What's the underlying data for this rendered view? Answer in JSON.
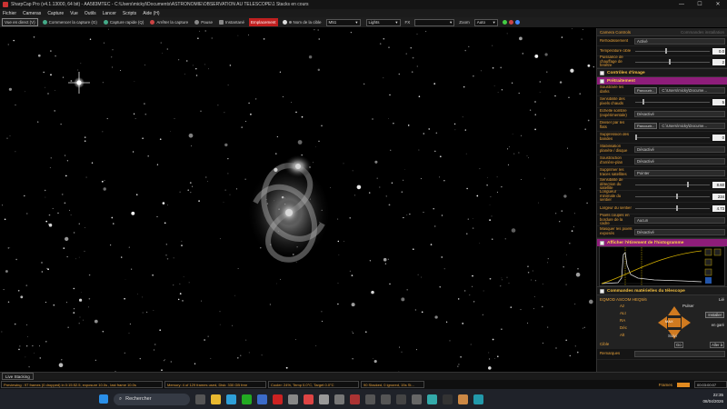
{
  "titlebar": {
    "title": "SharpCap Pro (v4.1.13000, 64 bit) - AA583MTEC - C:\\Users\\mickyl\\Documents\\ASTRONOMIE\\OBSERVATION AU TELESCOPE\\1 Stacks en cours"
  },
  "menu": [
    "Fichier",
    "Cameras",
    "Capture",
    "Vue",
    "Outils",
    "Lancer",
    "Scripts",
    "Aide (H)"
  ],
  "toolbar": {
    "live": "Vue en direct (V)",
    "start_capture": "Commencer la capture (G)",
    "quick_capture": "Capture rapide (Q)",
    "stop_capture": "Arrêter la capture",
    "pause": "Pause",
    "snapshot": "Instantané",
    "framing": "Emplacement",
    "target_label": "Nom de la cible",
    "target_value": "M51",
    "frame_type": "Lights",
    "fx_label": "FX",
    "fx_value": "",
    "zoom_label": "Zoom",
    "zoom_value": "Auto"
  },
  "panel": {
    "header": "Camera Controls",
    "minimized": "Commandes installation",
    "camera_rows": [
      {
        "label": "Refroidissement",
        "value": "Activé"
      },
      {
        "label": "Température cible",
        "num": "0.0"
      },
      {
        "label": "Puissance de chauffage de fenêtre",
        "num": "2"
      }
    ],
    "image_controls": "Contrôles d'image",
    "preprocessing": "Prétraitement",
    "pre_rows": [
      {
        "label": "Soustraire les darks",
        "btn": "Parcourir...",
        "value": "C:\\Users\\micky\\Docume..."
      },
      {
        "label": "Sensibilité des pixels chauds",
        "num": "5"
      },
      {
        "label": "Échelle sombre (expérimentale)",
        "value": "Désactivé"
      },
      {
        "label": "Diviser par les flats",
        "btn": "Parcourir...",
        "value": "C:\\Users\\micky\\Docume..."
      },
      {
        "label": "Suppression des bandes",
        "num": "0"
      },
      {
        "label": "Stabilisation planète / disque",
        "value": "Désactivé"
      },
      {
        "label": "Soustraction d'arrière-plan",
        "value": "Désactivé"
      },
      {
        "label": "Supprimer les traces satellites",
        "value": "Pointer"
      },
      {
        "label": "Sensibilité de détection du satellite",
        "num": "8.60"
      },
      {
        "label": "Longueur minimale du sentier",
        "num": "234"
      },
      {
        "label": "Largeur du sentier",
        "num": "4.73"
      },
      {
        "label": "Pixels coupés en bordure de la cadre",
        "value": "Aucun"
      },
      {
        "label": "Masquer les pixels exposés",
        "value": "Désactivé"
      }
    ],
    "histogram": "Afficher l'étirement de l'histogramme",
    "telescope": "Commandes matérielles du télescope",
    "mount": "EQMOD ASCOM HEQ5/6",
    "track_label": "Lié",
    "axes": [
      "Az",
      "ALt",
      "RA",
      "Déc",
      "Alt"
    ],
    "pulse": "Pulser",
    "install": "Installer",
    "park": "en garé",
    "speed": "Suivi",
    "center": "MAX",
    "target_lbl": "Cible",
    "goto": "Go",
    "goto_to": "Aller à",
    "remarks": "Remarques"
  },
  "livestack_tab": "Live Stacking",
  "status": [
    "Previewing : 97 frames (0 dropped) in 0:15:52.5, exposure 10.0s , last frame 10.0s",
    "Memory: 4 of 129 frames used, Disk: 330 GB free",
    "Cooler: 24%, Temp 0.0°C, Target 0.0°C",
    "90 Stacked, 0 ignored, 15s St..."
  ],
  "status_right": {
    "frames_label": "Frames",
    "time": "00:03:00:07"
  },
  "taskbar": {
    "search": "Rechercher",
    "time": "22:35",
    "date": "08/04/2026"
  },
  "colors": {
    "accent": "#e8a23a",
    "section_magenta": "#8e1d7a",
    "record_red": "#c02020"
  }
}
